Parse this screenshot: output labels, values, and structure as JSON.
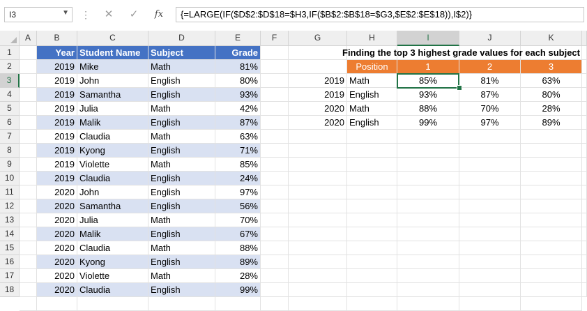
{
  "formula_bar": {
    "name_box": "I3",
    "cancel_icon": "✕",
    "enter_icon": "✓",
    "fx_label": "fx",
    "formula": "{=LARGE(IF($D$2:$D$18=$H3,IF($B$2:$B$18=$G3,$E$2:$E$18)),I$2)}"
  },
  "columns": [
    "A",
    "B",
    "C",
    "D",
    "E",
    "F",
    "G",
    "H",
    "I",
    "J",
    "K"
  ],
  "rows": [
    "1",
    "2",
    "3",
    "4",
    "5",
    "6",
    "7",
    "8",
    "9",
    "10",
    "11",
    "12",
    "13",
    "14",
    "15",
    "16",
    "17",
    "18"
  ],
  "selected_cell": "I3",
  "table": {
    "headers": [
      "Year",
      "Student Name",
      "Subject",
      "Grade"
    ],
    "rows": [
      [
        "2019",
        "Mike",
        "Math",
        "81%"
      ],
      [
        "2019",
        "John",
        "English",
        "80%"
      ],
      [
        "2019",
        "Samantha",
        "English",
        "93%"
      ],
      [
        "2019",
        "Julia",
        "Math",
        "42%"
      ],
      [
        "2019",
        "Malik",
        "English",
        "87%"
      ],
      [
        "2019",
        "Claudia",
        "Math",
        "63%"
      ],
      [
        "2019",
        "Kyong",
        "English",
        "71%"
      ],
      [
        "2019",
        "Violette",
        "Math",
        "85%"
      ],
      [
        "2019",
        "Claudia",
        "English",
        "24%"
      ],
      [
        "2020",
        "John",
        "English",
        "97%"
      ],
      [
        "2020",
        "Samantha",
        "English",
        "56%"
      ],
      [
        "2020",
        "Julia",
        "Math",
        "70%"
      ],
      [
        "2020",
        "Malik",
        "English",
        "67%"
      ],
      [
        "2020",
        "Claudia",
        "Math",
        "88%"
      ],
      [
        "2020",
        "Kyong",
        "English",
        "89%"
      ],
      [
        "2020",
        "Violette",
        "Math",
        "28%"
      ],
      [
        "2020",
        "Claudia",
        "English",
        "99%"
      ]
    ]
  },
  "results": {
    "title": "Finding the top 3 highest grade values for each subject",
    "position_label": "Position",
    "positions": [
      "1",
      "2",
      "3"
    ],
    "rows": [
      [
        "2019",
        "Math",
        "85%",
        "81%",
        "63%"
      ],
      [
        "2019",
        "English",
        "93%",
        "87%",
        "80%"
      ],
      [
        "2020",
        "Math",
        "88%",
        "70%",
        "28%"
      ],
      [
        "2020",
        "English",
        "99%",
        "97%",
        "89%"
      ]
    ]
  },
  "colors": {
    "table_header": "#4472c4",
    "band": "#d9e1f2",
    "position_header": "#ed7d31",
    "selection": "#217346"
  }
}
